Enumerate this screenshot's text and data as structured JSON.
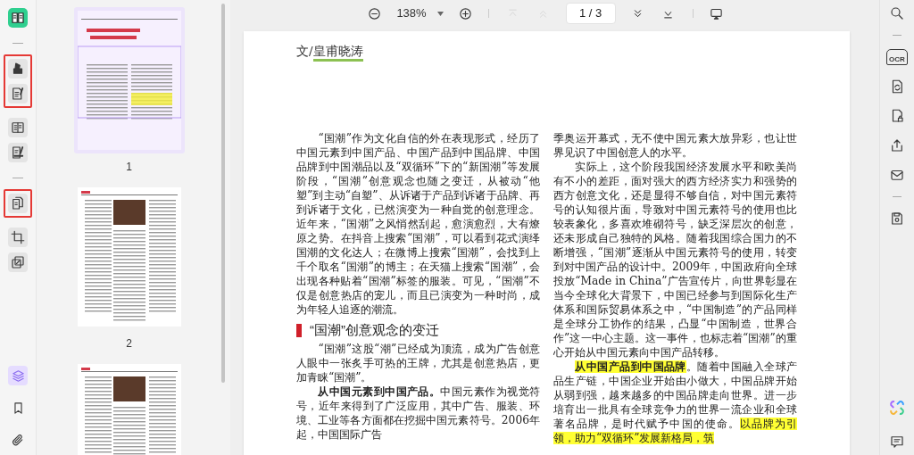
{
  "left_rail": {
    "sections": [
      {
        "groups": [
          {
            "outlined": false,
            "tools": [
              {
                "kind": "app"
              }
            ]
          }
        ]
      },
      {
        "groups": [
          {
            "outlined": true,
            "tools": [
              {
                "kind": "highlighter"
              },
              {
                "kind": "edit"
              }
            ]
          },
          {
            "outlined": false,
            "tools": [
              {
                "kind": "reader"
              },
              {
                "kind": "sign"
              }
            ]
          }
        ]
      },
      {
        "groups": [
          {
            "outlined": true,
            "tools": [
              {
                "kind": "pages"
              }
            ]
          },
          {
            "outlined": false,
            "tools": [
              {
                "kind": "crop"
              },
              {
                "kind": "compare"
              }
            ]
          }
        ]
      }
    ],
    "bottom_tools": [
      {
        "kind": "layers",
        "selected": true
      },
      {
        "kind": "bookmark",
        "selected": false
      },
      {
        "kind": "attachment",
        "selected": false
      }
    ]
  },
  "thumbnails": {
    "pages": [
      {
        "kind": "title",
        "label": "1",
        "selected": true
      },
      {
        "kind": "photo",
        "label": "2",
        "selected": false
      },
      {
        "kind": "photo",
        "selected": false
      }
    ]
  },
  "toolbar": {
    "zoom": "138%",
    "page": "1 / 3",
    "nav": [
      {
        "kind": "first",
        "disabled": true
      },
      {
        "kind": "previous",
        "disabled": true
      },
      {
        "kind": "next",
        "disabled": false
      },
      {
        "kind": "last",
        "disabled": false
      }
    ]
  },
  "document": {
    "author": [
      {
        "text": "文/",
        "underlined": false
      },
      {
        "text": "皇甫晓涛",
        "underlined": true
      }
    ],
    "columns": [
      [
        {
          "kind": "paragraph",
          "indent": true,
          "segments": [
            {
              "text": "“国潮”作为文化自信的外在表现形式，经历了中国元素到中国产品、中国产品到中国品牌、中国品牌到中国潮品以及“双循环”下的“新国潮”等发展阶段，“国潮”创意观念也随之变迁，从被动“他塑”到主动“自塑”、从诉诸于产品到诉诸于品牌、再到诉诸于文化，已然演变为一种自觉的创意理念。近年来，“国潮”之风悄然刮起，愈演愈烈，大有燎原之势。在抖音上搜索“国潮”，可以看到花式演绎国潮的文化达人；在微博上搜索“国潮”，会找到上千个取名“国潮”的博主；在天猫上搜索“国潮”，会出现各种贴着“国潮”标签的服装。可见，“国潮”不仅是创意热店的宠儿，而且已演变为一种时尚，成为年轻人追逐的潮流。",
              "bold": false,
              "highlighted": false
            }
          ]
        },
        {
          "kind": "heading",
          "text": "“国潮”创意观念的变迁"
        },
        {
          "kind": "paragraph",
          "indent": true,
          "segments": [
            {
              "text": "“国潮”这股“潮”已经成为顶流，成为广告创意人眼中一张炙手可热的王牌，尤其是创意热店，更加青睐“国潮”。",
              "bold": false,
              "highlighted": false
            }
          ]
        },
        {
          "kind": "paragraph",
          "indent": true,
          "segments": [
            {
              "text": "从中国元素到中国产品。",
              "bold": true,
              "highlighted": false
            },
            {
              "text": "中国元素作为视觉符号，近年来得到了广泛应用，其中广告、服装、环境、工业等各方面都在挖掘中国元素符号。2006年起，中国国际广告",
              "bold": false,
              "highlighted": false
            }
          ]
        }
      ],
      [
        {
          "kind": "paragraph",
          "indent": false,
          "segments": [
            {
              "text": "季奥运开幕式，无不使中国元素大放异彩，也让世界见识了中国创意人的水平。",
              "bold": false,
              "highlighted": false
            }
          ]
        },
        {
          "kind": "paragraph",
          "indent": true,
          "segments": [
            {
              "text": "实际上，这个阶段我国经济发展水平和欧美尚有不小的差距，面对强大的西方经济实力和强势的西方创意文化，还是显得不够自信，对中国元素符号的认知很片面，导致对中国元素符号的使用也比较表象化，多喜欢堆砌符号，缺乏深层次的创意，还未形成自己独特的风格。随着我国综合国力的不断增强，“国潮”逐渐从中国元素符号的使用，转变到对中国产品的设计中。2009年，中国政府向全球投放“Made in China”广告宣传片，向世界彰显在当今全球化大背景下，中国已经参与到国际化生产体系和国际贸易体系之中，“中国制造”的产品同样是全球分工协作的结果，凸显“中国制造，世界合作”这一中心主题。这一事件，也标志着“国潮”的重心开始从中国元素向中国产品转移。",
              "bold": false,
              "highlighted": false
            }
          ]
        },
        {
          "kind": "paragraph",
          "indent": true,
          "segments": [
            {
              "text": "从中国产品到中国品牌",
              "bold": true,
              "highlighted": true
            },
            {
              "text": "。随着中国融入全球产品生产链，中国企业开始由小做大，中国品牌开始从弱到强，越来越多的中国品牌走向世界。进一步培育出一批具有全球竞争力的世界一流企业和全球著名品牌，是时代赋予中国的使命。",
              "bold": false,
              "highlighted": false
            },
            {
              "text": "以品牌为引领，助力“双循环”发展新格局，筑",
              "bold": false,
              "highlighted": true
            }
          ]
        }
      ]
    ]
  },
  "right_rail": {
    "sections": [
      {
        "tools": [
          {
            "kind": "search"
          }
        ]
      },
      {
        "tools": [
          {
            "kind": "ocr",
            "label": "OCR"
          },
          {
            "kind": "convert"
          },
          {
            "kind": "protect"
          },
          {
            "kind": "share"
          },
          {
            "kind": "mail"
          }
        ]
      },
      {
        "tools": [
          {
            "kind": "save"
          }
        ]
      }
    ],
    "bottom_tools": [
      {
        "kind": "ai"
      },
      {
        "kind": "comment"
      }
    ]
  }
}
